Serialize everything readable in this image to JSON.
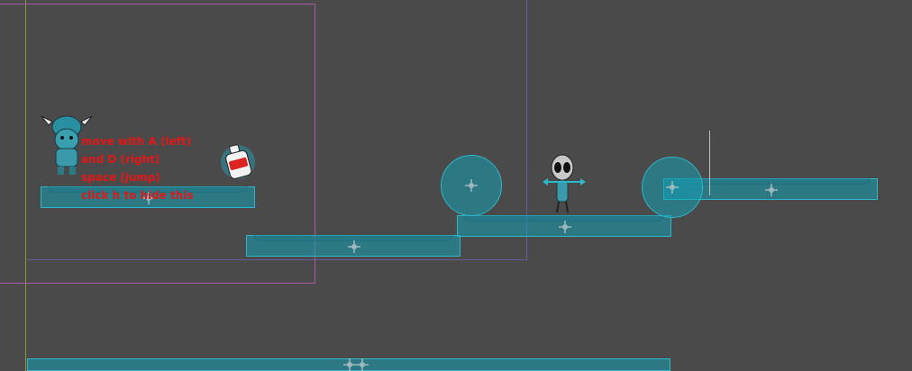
{
  "instructions": {
    "line1": "move with A (left)",
    "line2": "and D (right)",
    "line3": "space (jump)",
    "line4": "click h to hide this"
  },
  "colors": {
    "background": "#4a4a4a",
    "platform_fill": "#14a0b4",
    "platform_border": "#2fb6c9",
    "instruction_text": "#e01818",
    "boundary_pink": "#a95aa0",
    "boundary_purple": "#6a5a9a",
    "axis_green": "#8a9a3a"
  },
  "sprites": {
    "player": "viking-player-sprite",
    "enemy": "alien-enemy-sprite",
    "pickup": "bottle-pickup-sprite"
  }
}
